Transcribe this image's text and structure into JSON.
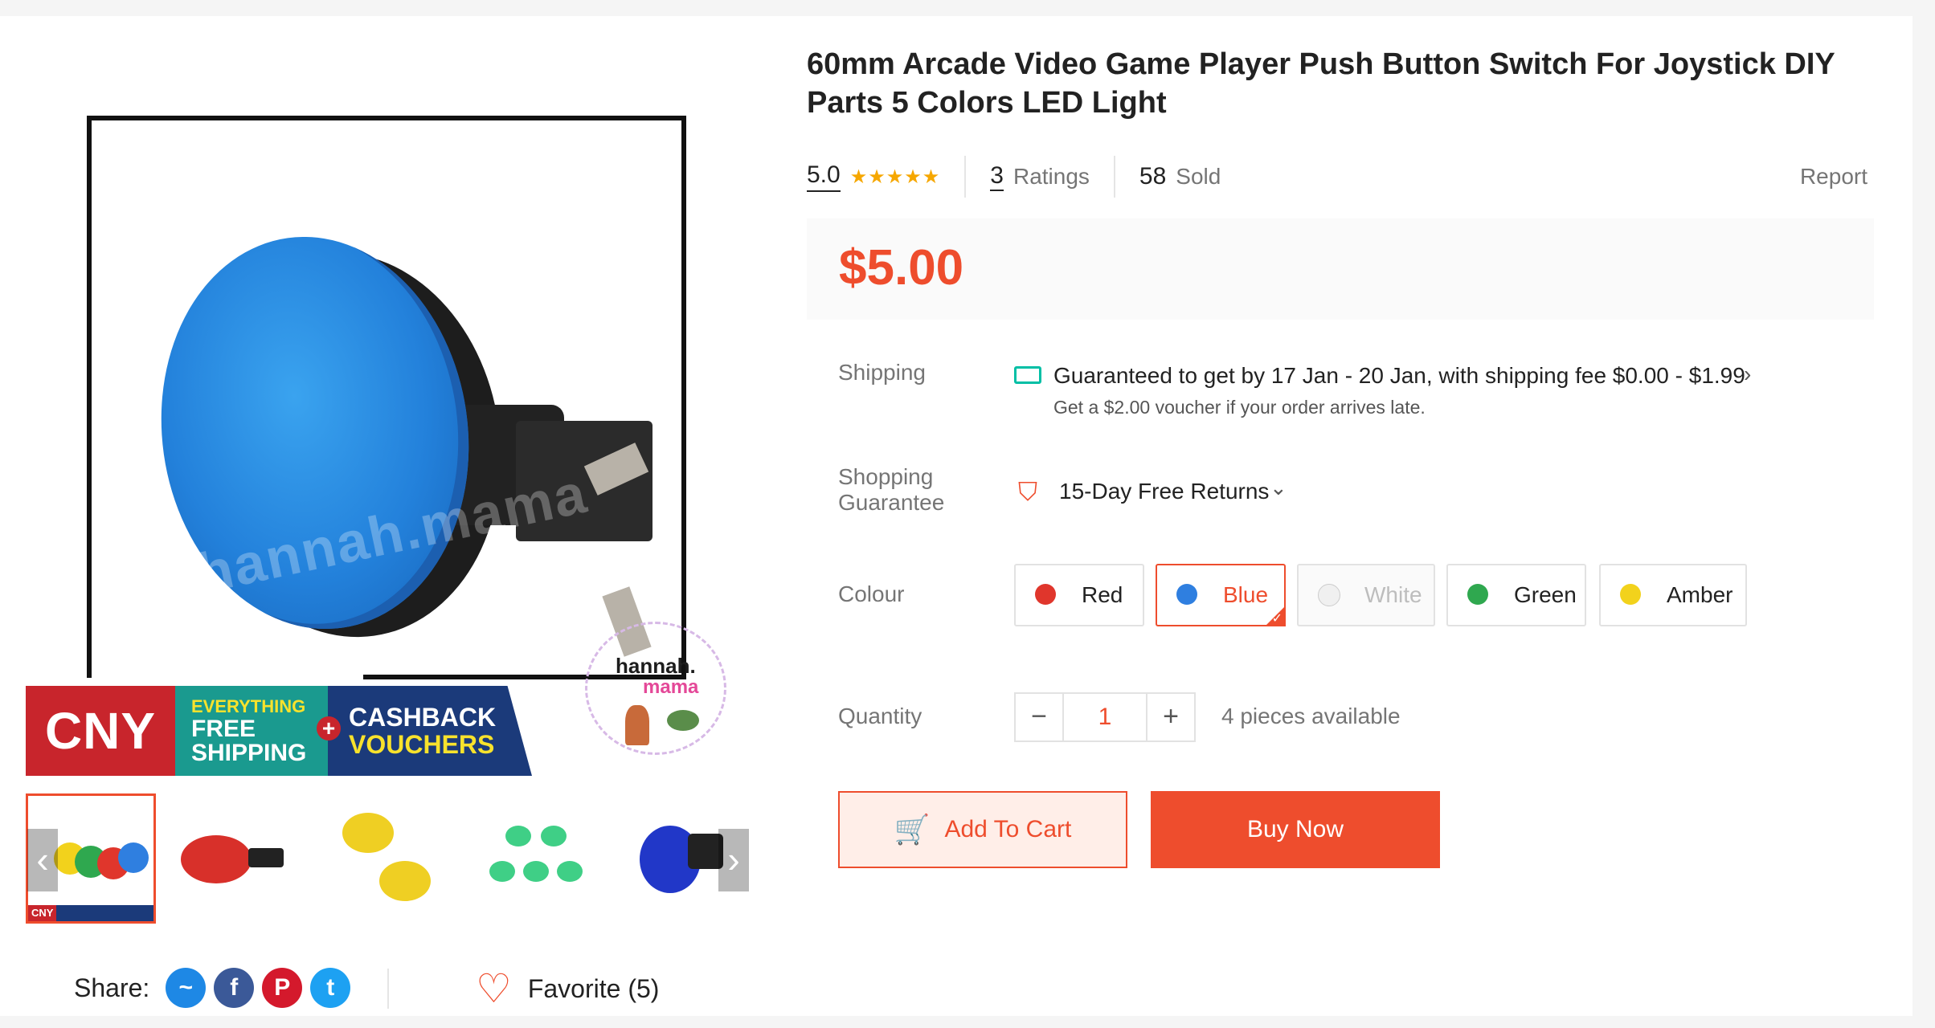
{
  "product": {
    "title": "60mm Arcade Video Game Player Push Button Switch For Joystick DIY Parts 5 Colors LED Light",
    "rating": "5.0",
    "stars": "★★★★★",
    "ratings_count": "3",
    "ratings_label": "Ratings",
    "sold_count": "58",
    "sold_label": "Sold",
    "report_label": "Report",
    "price": "$5.00"
  },
  "gallery": {
    "watermark": "hannah.mama",
    "promo": {
      "cny": "CNY",
      "everything": "EVERYTHING",
      "free": "FREE",
      "shipping": "SHIPPING",
      "plus": "+",
      "cashback": "CASHBACK",
      "vouchers": "VOUCHERS"
    },
    "shop_logo": {
      "line1": "hannah.",
      "line2": "mama"
    },
    "thumb_prev": "‹",
    "thumb_next": "›",
    "thumb_mini_label": "CNY"
  },
  "shipping": {
    "label": "Shipping",
    "main": "Guaranteed to get by 17 Jan - 20 Jan, with shipping fee $0.00 - $1.99",
    "chevron": "›",
    "sub": "Get a $2.00 voucher if your order arrives late."
  },
  "guarantee": {
    "label_line1": "Shopping",
    "label_line2": "Guarantee",
    "icon": "shield-check-icon",
    "text": "15-Day Free Returns",
    "chevron": "⌄"
  },
  "colour": {
    "label": "Colour",
    "options": [
      {
        "label": "Red",
        "color": "#e0362c",
        "state": "normal"
      },
      {
        "label": "Blue",
        "color": "#2f7fe0",
        "state": "selected"
      },
      {
        "label": "White",
        "color": "#f0f0f0",
        "state": "disabled"
      },
      {
        "label": "Green",
        "color": "#2fa84f",
        "state": "normal"
      },
      {
        "label": "Amber",
        "color": "#f2d21c",
        "state": "normal"
      }
    ]
  },
  "quantity": {
    "label": "Quantity",
    "minus": "−",
    "value": "1",
    "plus": "+",
    "available": "4 pieces available"
  },
  "actions": {
    "add_to_cart": "Add To Cart",
    "buy_now": "Buy Now"
  },
  "share": {
    "label": "Share:",
    "icons": [
      "messenger-icon",
      "facebook-icon",
      "pinterest-icon",
      "twitter-icon"
    ]
  },
  "favorite": {
    "label": "Favorite (5)"
  },
  "colors": {
    "accent": "#ee4d2d",
    "star": "#f6a700",
    "teal": "#00bfa5"
  }
}
